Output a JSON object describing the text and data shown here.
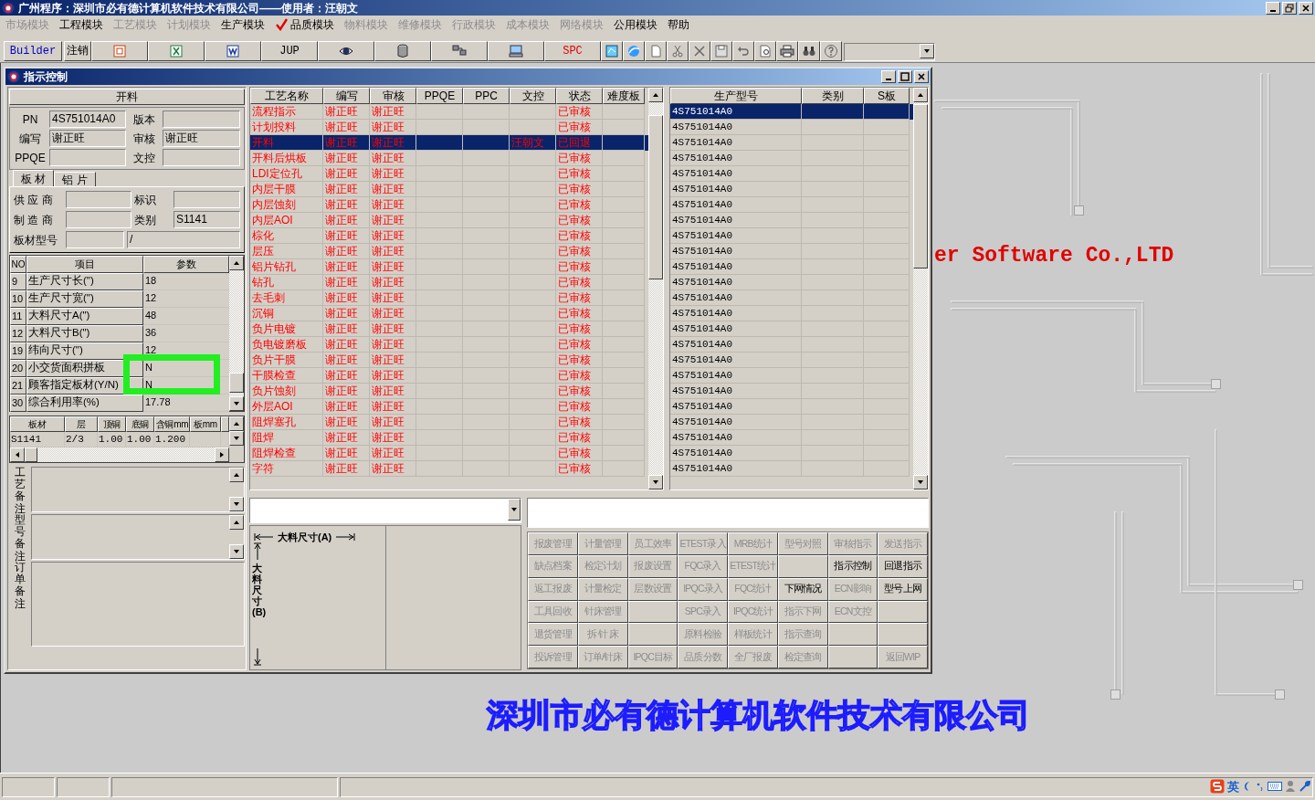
{
  "window": {
    "title": "广州程序：深圳市必有德计算机软件技术有限公司——使用者：汪朝文"
  },
  "menu": [
    {
      "label": "市场模块",
      "disabled": true,
      "checked": false
    },
    {
      "label": "工程模块",
      "disabled": false,
      "checked": false
    },
    {
      "label": "工艺模块",
      "disabled": true,
      "checked": false
    },
    {
      "label": "计划模块",
      "disabled": true,
      "checked": false
    },
    {
      "label": "生产模块",
      "disabled": false,
      "checked": false
    },
    {
      "label": "品质模块",
      "disabled": false,
      "checked": true
    },
    {
      "label": "物料模块",
      "disabled": true,
      "checked": false
    },
    {
      "label": "维修模块",
      "disabled": true,
      "checked": false
    },
    {
      "label": "行政模块",
      "disabled": true,
      "checked": false
    },
    {
      "label": "成本模块",
      "disabled": true,
      "checked": false
    },
    {
      "label": "网络模块",
      "disabled": true,
      "checked": false
    },
    {
      "label": "公用模块",
      "disabled": false,
      "checked": false
    },
    {
      "label": "帮助",
      "disabled": false,
      "checked": false
    }
  ],
  "toolbar": [
    {
      "kind": "text",
      "label": "Builder",
      "color": "#0000c0"
    },
    {
      "kind": "text",
      "label": "注销",
      "color": "#000000"
    },
    {
      "kind": "icon"
    },
    {
      "kind": "icon"
    },
    {
      "kind": "icon"
    },
    {
      "kind": "text",
      "label": "JUP",
      "color": "#000000"
    },
    {
      "kind": "icon"
    },
    {
      "kind": "icon"
    },
    {
      "kind": "icon"
    },
    {
      "kind": "icon"
    },
    {
      "kind": "text",
      "label": "SPC",
      "color": "#e00000"
    },
    {
      "kind": "small"
    },
    {
      "kind": "small"
    },
    {
      "kind": "small"
    },
    {
      "kind": "small"
    },
    {
      "kind": "small"
    },
    {
      "kind": "small"
    },
    {
      "kind": "small"
    },
    {
      "kind": "small"
    },
    {
      "kind": "small"
    },
    {
      "kind": "small"
    },
    {
      "kind": "small"
    }
  ],
  "desktop": {
    "company_en": "er Software Co.,LTD",
    "company_cn": "深圳市必有德计算机软件技术有限公司"
  },
  "child_window": {
    "title": "指示控制"
  },
  "form": {
    "header": "开料",
    "fields": [
      {
        "label": "PN",
        "value": "4S751014A0"
      },
      {
        "label": "版本"
      },
      {
        "label": "编写",
        "value": "谢正旺"
      },
      {
        "label": "审核",
        "value": "谢正旺"
      },
      {
        "label": "PPQE"
      },
      {
        "label": "文控"
      }
    ]
  },
  "material_tabs": [
    {
      "label": "板 材",
      "selected": true
    },
    {
      "label": "铝 片",
      "selected": false
    }
  ],
  "material_fields": [
    {
      "label": "供 应 商"
    },
    {
      "label": "标识"
    },
    {
      "label": "制 造 商"
    },
    {
      "label": "类别",
      "value": "S1141"
    }
  ],
  "material_model": {
    "label": "板材型号",
    "extra_value": "/"
  },
  "parameters": {
    "columns": [
      "NO",
      "项目",
      "参数"
    ],
    "rows": [
      [
        "9",
        "生产尺寸长(\")",
        "18"
      ],
      [
        "10",
        "生产尺寸宽(\")",
        "12"
      ],
      [
        "11",
        "大料尺寸A(\")",
        "48"
      ],
      [
        "12",
        "大料尺寸B(\")",
        "36"
      ],
      [
        "19",
        "纬向尺寸(\")",
        "12"
      ],
      [
        "20",
        "小交货面积拼板",
        "N"
      ],
      [
        "21",
        "顾客指定板材(Y/N)",
        "N"
      ],
      [
        "30",
        "综合利用率(%)",
        "17.78"
      ]
    ]
  },
  "stackup": {
    "columns": [
      "板材",
      "层",
      "顶铜",
      "底铜",
      "含铜mm",
      "板mm"
    ],
    "rows": [
      [
        "S1141",
        "2/3",
        "1.00",
        "1.00",
        "1.200"
      ]
    ]
  },
  "remarks": [
    "工艺备注",
    "型号备注",
    "订单备注"
  ],
  "process_table": {
    "columns": [
      "工艺名称",
      "编写",
      "审核",
      "PPQE",
      "PPC",
      "文控",
      "状态",
      "难度板"
    ],
    "rows": [
      {
        "name": "流程指示",
        "writer": "谢正旺",
        "reviewer": "谢正旺",
        "status": "已审核",
        "selected": false
      },
      {
        "name": "计划投料",
        "writer": "谢正旺",
        "reviewer": "谢正旺",
        "status": "已审核",
        "selected": false
      },
      {
        "name": "开料",
        "writer": "谢正旺",
        "reviewer": "谢正旺",
        "doc_control": "汪朝文",
        "status": "已回退",
        "selected": true
      },
      {
        "name": "开料后烘板",
        "writer": "谢正旺",
        "reviewer": "谢正旺",
        "status": "已审核",
        "selected": false
      },
      {
        "name": "LDI定位孔",
        "writer": "谢正旺",
        "reviewer": "谢正旺",
        "status": "已审核",
        "selected": false
      },
      {
        "name": "内层干膜",
        "writer": "谢正旺",
        "reviewer": "谢正旺",
        "status": "已审核",
        "selected": false
      },
      {
        "name": "内层蚀刻",
        "writer": "谢正旺",
        "reviewer": "谢正旺",
        "status": "已审核",
        "selected": false
      },
      {
        "name": "内层AOI",
        "writer": "谢正旺",
        "reviewer": "谢正旺",
        "status": "已审核",
        "selected": false
      },
      {
        "name": "棕化",
        "writer": "谢正旺",
        "reviewer": "谢正旺",
        "status": "已审核",
        "selected": false
      },
      {
        "name": "层压",
        "writer": "谢正旺",
        "reviewer": "谢正旺",
        "status": "已审核",
        "selected": false
      },
      {
        "name": "铝片钻孔",
        "writer": "谢正旺",
        "reviewer": "谢正旺",
        "status": "已审核",
        "selected": false
      },
      {
        "name": "钻孔",
        "writer": "谢正旺",
        "reviewer": "谢正旺",
        "status": "已审核",
        "selected": false
      },
      {
        "name": "去毛刺",
        "writer": "谢正旺",
        "reviewer": "谢正旺",
        "status": "已审核",
        "selected": false
      },
      {
        "name": "沉铜",
        "writer": "谢正旺",
        "reviewer": "谢正旺",
        "status": "已审核",
        "selected": false
      },
      {
        "name": "负片电镀",
        "writer": "谢正旺",
        "reviewer": "谢正旺",
        "status": "已审核",
        "selected": false
      },
      {
        "name": "负电镀磨板",
        "writer": "谢正旺",
        "reviewer": "谢正旺",
        "status": "已审核",
        "selected": false
      },
      {
        "name": "负片干膜",
        "writer": "谢正旺",
        "reviewer": "谢正旺",
        "status": "已审核",
        "selected": false
      },
      {
        "name": "干膜检查",
        "writer": "谢正旺",
        "reviewer": "谢正旺",
        "status": "已审核",
        "selected": false
      },
      {
        "name": "负片蚀刻",
        "writer": "谢正旺",
        "reviewer": "谢正旺",
        "status": "已审核",
        "selected": false
      },
      {
        "name": "外层AOI",
        "writer": "谢正旺",
        "reviewer": "谢正旺",
        "status": "已审核",
        "selected": false
      },
      {
        "name": "阻焊塞孔",
        "writer": "谢正旺",
        "reviewer": "谢正旺",
        "status": "已审核",
        "selected": false
      },
      {
        "name": "阻焊",
        "writer": "谢正旺",
        "reviewer": "谢正旺",
        "status": "已审核",
        "selected": false
      },
      {
        "name": "阻焊检查",
        "writer": "谢正旺",
        "reviewer": "谢正旺",
        "status": "已审核",
        "selected": false
      },
      {
        "name": "字符",
        "writer": "谢正旺",
        "reviewer": "谢正旺",
        "status": "已审核",
        "selected": false
      }
    ]
  },
  "model_table": {
    "columns": [
      "生产型号",
      "类别",
      "S板"
    ],
    "rows": [
      {
        "model": "4S751014A0",
        "selected": true
      },
      {
        "model": "4S751014A0",
        "selected": false
      },
      {
        "model": "4S751014A0",
        "selected": false
      },
      {
        "model": "4S751014A0",
        "selected": false
      },
      {
        "model": "4S751014A0",
        "selected": false
      },
      {
        "model": "4S751014A0",
        "selected": false
      },
      {
        "model": "4S751014A0",
        "selected": false
      },
      {
        "model": "4S751014A0",
        "selected": false
      },
      {
        "model": "4S751014A0",
        "selected": false
      },
      {
        "model": "4S751014A0",
        "selected": false
      },
      {
        "model": "4S751014A0",
        "selected": false
      },
      {
        "model": "4S751014A0",
        "selected": false
      },
      {
        "model": "4S751014A0",
        "selected": false
      },
      {
        "model": "4S751014A0",
        "selected": false
      },
      {
        "model": "4S751014A0",
        "selected": false
      },
      {
        "model": "4S751014A0",
        "selected": false
      },
      {
        "model": "4S751014A0",
        "selected": false
      },
      {
        "model": "4S751014A0",
        "selected": false
      },
      {
        "model": "4S751014A0",
        "selected": false
      },
      {
        "model": "4S751014A0",
        "selected": false
      },
      {
        "model": "4S751014A0",
        "selected": false
      },
      {
        "model": "4S751014A0",
        "selected": false
      },
      {
        "model": "4S751014A0",
        "selected": false
      },
      {
        "model": "4S751014A0",
        "selected": false
      }
    ]
  },
  "dimensions": {
    "width_label": "大料尺寸(A)",
    "height_label": "大料尺寸(B)"
  },
  "function_buttons": [
    {
      "kind": "button",
      "label": "报废管理",
      "disabled": true
    },
    {
      "kind": "button",
      "label": "计量管理",
      "disabled": true
    },
    {
      "kind": "button",
      "label": "员工效率",
      "disabled": true
    },
    {
      "kind": "button",
      "label": "ETEST录入",
      "disabled": true
    },
    {
      "kind": "button",
      "label": "MRB统计",
      "disabled": true
    },
    {
      "kind": "button",
      "label": "型号对照",
      "disabled": true
    },
    {
      "kind": "button",
      "label": "审核指示",
      "disabled": true
    },
    {
      "kind": "button",
      "label": "发送指示",
      "disabled": true
    },
    {
      "kind": "button",
      "label": "缺点档案",
      "disabled": true
    },
    {
      "kind": "button",
      "label": "检定计划",
      "disabled": true
    },
    {
      "kind": "button",
      "label": "报废设置",
      "disabled": true
    },
    {
      "kind": "button",
      "label": "FQC录入",
      "disabled": true
    },
    {
      "kind": "button",
      "label": "ETEST统计",
      "disabled": true
    },
    {
      "kind": "empty"
    },
    {
      "kind": "button",
      "label": "指示控制",
      "disabled": false
    },
    {
      "kind": "button",
      "label": "回退指示",
      "disabled": false
    },
    {
      "kind": "button",
      "label": "返工报废",
      "disabled": true
    },
    {
      "kind": "button",
      "label": "计量检定",
      "disabled": true
    },
    {
      "kind": "button",
      "label": "层数设置",
      "disabled": true
    },
    {
      "kind": "button",
      "label": "IPQC录入",
      "disabled": true
    },
    {
      "kind": "button",
      "label": "FQC统计",
      "disabled": true
    },
    {
      "kind": "button",
      "label": "下网情况",
      "disabled": false
    },
    {
      "kind": "button",
      "label": "ECN影响",
      "disabled": true
    },
    {
      "kind": "button",
      "label": "型号上网",
      "disabled": false
    },
    {
      "kind": "button",
      "label": "工具回收",
      "disabled": true
    },
    {
      "kind": "button",
      "label": "针床管理",
      "disabled": true
    },
    {
      "kind": "empty"
    },
    {
      "kind": "button",
      "label": "SPC录入",
      "disabled": true
    },
    {
      "kind": "button",
      "label": "IPQC统计",
      "disabled": true
    },
    {
      "kind": "button",
      "label": "指示下网",
      "disabled": true
    },
    {
      "kind": "button",
      "label": "ECN文控",
      "disabled": true
    },
    {
      "kind": "empty"
    },
    {
      "kind": "button",
      "label": "退货管理",
      "disabled": true
    },
    {
      "kind": "button",
      "label": "拆 针 床",
      "disabled": true
    },
    {
      "kind": "empty"
    },
    {
      "kind": "button",
      "label": "原料检验",
      "disabled": true
    },
    {
      "kind": "button",
      "label": "样板统计",
      "disabled": true
    },
    {
      "kind": "button",
      "label": "指示查询",
      "disabled": true
    },
    {
      "kind": "empty"
    },
    {
      "kind": "empty"
    },
    {
      "kind": "button",
      "label": "投诉管理",
      "disabled": true
    },
    {
      "kind": "button",
      "label": "订单/针床",
      "disabled": true
    },
    {
      "kind": "button",
      "label": "IPQC目标",
      "disabled": true
    },
    {
      "kind": "button",
      "label": "品质分数",
      "disabled": true
    },
    {
      "kind": "button",
      "label": "全厂报废",
      "disabled": true
    },
    {
      "kind": "button",
      "label": "检定查询",
      "disabled": true
    },
    {
      "kind": "empty"
    },
    {
      "kind": "button",
      "label": "返回WIP",
      "disabled": true
    }
  ],
  "tray": {
    "ime_label": "英"
  }
}
